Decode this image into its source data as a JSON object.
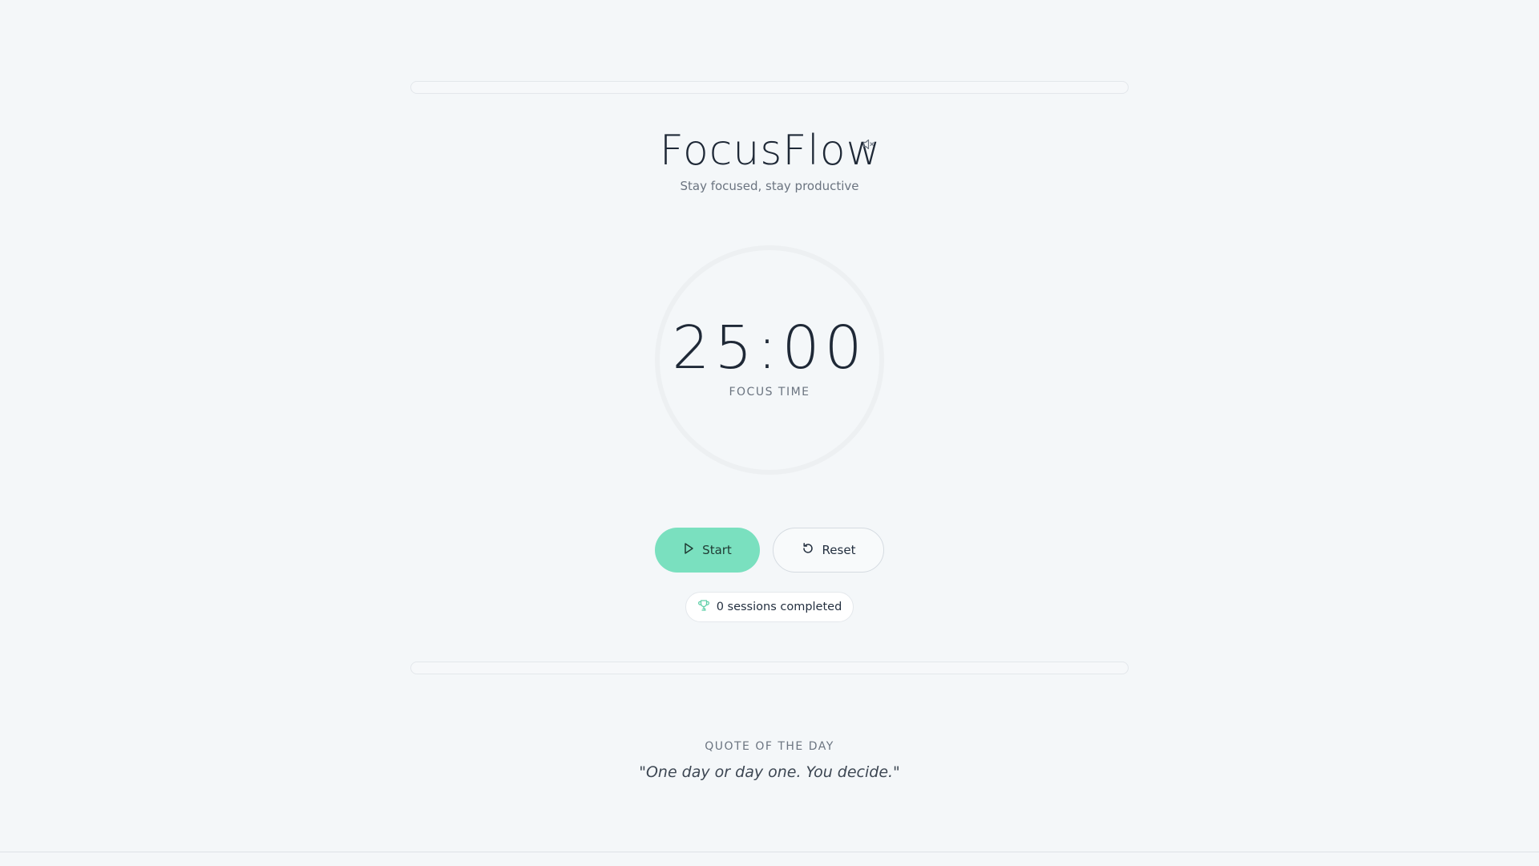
{
  "app": {
    "title": "FocusFlow",
    "subtitle": "Stay focused, stay productive",
    "mute_icon": "volume-mute-icon"
  },
  "progress": {
    "top_fraction": 0,
    "bottom_fraction": 0
  },
  "timer": {
    "time": "25:00",
    "mode_label": "FOCUS TIME",
    "progress_fraction": 0
  },
  "controls": {
    "start_label": "Start",
    "start_icon": "play-icon",
    "reset_label": "Reset",
    "reset_icon": "reset-icon"
  },
  "sessions": {
    "text": "0 sessions completed",
    "icon": "trophy-icon"
  },
  "quote": {
    "heading": "QUOTE OF THE DAY",
    "text": "\"One day or day one. You decide.\""
  },
  "colors": {
    "background": "#f4f7f9",
    "accent": "#7ae0bf",
    "ring_track": "#edf0f2",
    "text_primary": "#1f2937",
    "text_muted": "#6b7480"
  }
}
